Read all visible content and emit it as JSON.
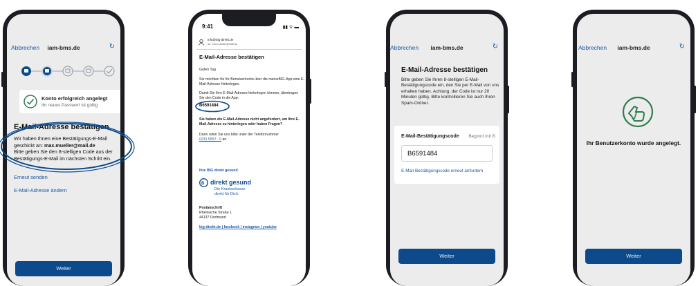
{
  "screen1": {
    "nav": {
      "cancel": "Abbrechen",
      "host": "iam-bms.de",
      "reload_icon": "↻"
    },
    "success_title": "Konto erfolgreich angelegt",
    "success_subtitle": "Ihr neues Passwort ist gültig",
    "heading": "E-Mail-Adresse bestätigen",
    "body_line1": "Wir haben Ihnen eine Bestätigungs-E-Mail",
    "body_line2_prefix": "geschickt an: ",
    "body_email": "max.mueller@mail.de",
    "body_line3": "Bitte geben Sie den 8-stelligen Code aus der",
    "body_line4": "Bestätigungs-E-Mail im nächsten Schritt ein.",
    "resend": "Erneut senden",
    "change_email": "E-Mail-Adresse ändern",
    "next": "Weiter"
  },
  "screen2": {
    "time": "9:41",
    "status_icons": "▮▮ ᯤ ▬",
    "from": "info@big-direkt.de",
    "to": "an: max.mueller@mail.de",
    "subject": "E-Mail-Adresse bestätigen",
    "greeting": "Guten Tag",
    "p1": "Sie möchten für Ihr Benutzerkonto über die meineBIG-App eine E-Mail-Adresse hinterlegen.",
    "p2": "Damit Sie Ihre E-Mail-Adresse hinterlegen können, übertragen Sie den Code in die App:",
    "code": "B6591484",
    "question": "Sie haben die E-Mail-Adresse nicht angefordert, um Ihre E-Mail-Adresse zu hinterlegen oder haben Fragen?",
    "call_prefix": "Dann rufen Sie uns bitte unter der Telefonnummer",
    "phone": "0231 5557 - 0",
    "call_suffix": " an.",
    "signoff": "Ihre BIG direkt gesund",
    "logo_name": "direkt gesund",
    "logo_tag1": "Die Krankenkasse",
    "logo_tag2": "direkt für Dich.",
    "address_title": "Postanschrift",
    "address_1": "Rheinische Straße 1",
    "address_2": "44137 Dortmund",
    "links": "big-direkt.de | facebook | instagram | youtube"
  },
  "screen3": {
    "nav": {
      "cancel": "Abbrechen",
      "host": "iam-bms.de",
      "reload_icon": "↻"
    },
    "heading": "E-Mail-Adresse bestätigen",
    "body": "Bitte geben Sie Ihren 8-stelligen E-Mail-Bestätigungscode ein, den Sie per E-Mail von uns erhalten haben. Achtung, der Code ist nur 20 Minuten gültig. Bitte kontrollieren Sie auch Ihren Spam-Ordner.",
    "field_label": "E-Mail-Bestätigungscode",
    "field_hint": "Beginnt mit B",
    "field_value": "B6591484",
    "resend": "E-Mail-Bestätigungscode erneut anfordern",
    "next": "Weiter"
  },
  "screen4": {
    "nav": {
      "cancel": "Abbrechen",
      "host": "iam-bms.de",
      "reload_icon": "↻"
    },
    "message": "Ihr Benutzerkonto wurde angelegt.",
    "next": "Weiter"
  },
  "colors": {
    "primary": "#0d4a8c",
    "link": "#1a5aa8",
    "success": "#2d7d4a"
  }
}
